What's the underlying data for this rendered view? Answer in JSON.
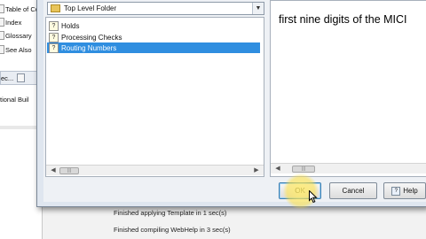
{
  "sidebar": {
    "items": [
      {
        "label": "Table of Co"
      },
      {
        "label": "Index"
      },
      {
        "label": "Glossary"
      },
      {
        "label": "See Also"
      }
    ],
    "tab_label": "ec...",
    "partial_text": "tional Buil"
  },
  "output_log": {
    "lines": [
      "Finished applying Template in 1 sec(s)",
      "Finished compiling WebHelp in 3 sec(s)"
    ]
  },
  "dialog": {
    "folder_select": {
      "value": "Top Level Folder"
    },
    "topics": [
      {
        "label": "Holds",
        "selected": false
      },
      {
        "label": "Processing Checks",
        "selected": false
      },
      {
        "label": "Routing Numbers",
        "selected": true
      }
    ],
    "preview": {
      "text": "first nine digits of the MICI"
    },
    "buttons": {
      "ok": "OK",
      "cancel": "Cancel",
      "help": "Help"
    }
  },
  "colors": {
    "selection": "#2f8ee0",
    "dialog_frame": "#dfe6ef",
    "cursor_highlight": "#ffe13c"
  }
}
